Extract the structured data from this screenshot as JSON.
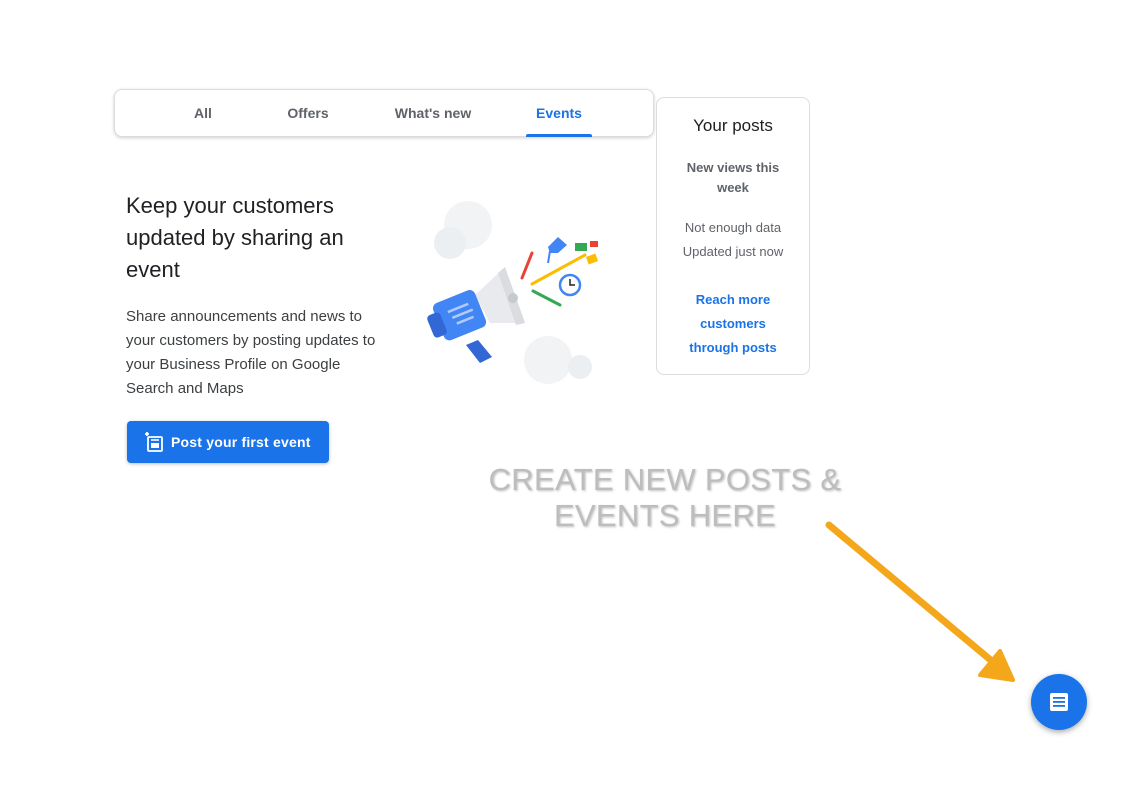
{
  "tabs": [
    {
      "label": "All",
      "active": false
    },
    {
      "label": "Offers",
      "active": false
    },
    {
      "label": "What's new",
      "active": false
    },
    {
      "label": "Events",
      "active": true
    }
  ],
  "empty_state": {
    "headline": "Keep your customers updated by sharing an event",
    "description": "Share announcements and news to your customers by posting updates to your Business Profile on Google Search and Maps",
    "button_label": "Post your first event",
    "illustration_icon": "megaphone-illustration"
  },
  "posts_card": {
    "title": "Your posts",
    "subtitle": "New views this week",
    "no_data": "Not enough data",
    "updated": "Updated just now",
    "link": "Reach more customers through posts"
  },
  "annotation": {
    "line1": "CREATE NEW POSTS &",
    "line2": "EVENTS HERE",
    "arrow_color": "#f5a71c"
  },
  "fab": {
    "icon": "create-post-icon"
  },
  "colors": {
    "accent": "#1a73e8",
    "text": "#202124",
    "muted": "#5f6368"
  }
}
